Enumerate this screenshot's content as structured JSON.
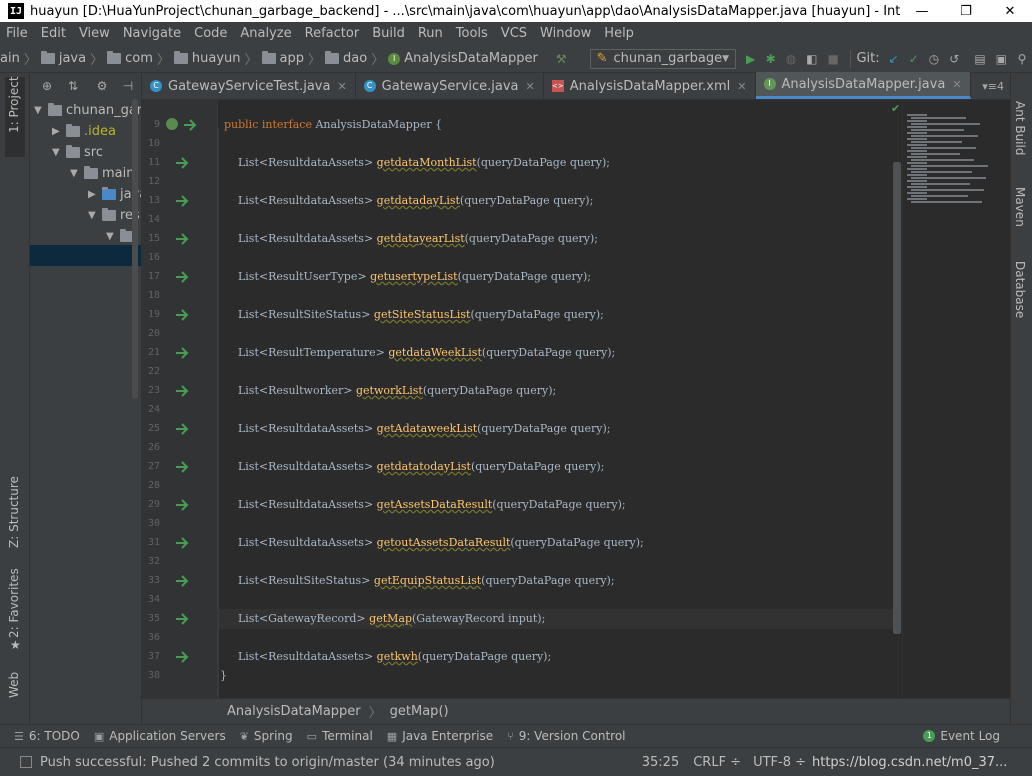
{
  "window": {
    "title": "huayun [D:\\HuaYunProject\\chunan_garbage_backend] - ...\\src\\main\\java\\com\\huayun\\app\\dao\\AnalysisDataMapper.java [huayun] - IntelliJ IDEA",
    "app_icon_text": "IJ"
  },
  "menu": [
    "File",
    "Edit",
    "View",
    "Navigate",
    "Code",
    "Analyze",
    "Refactor",
    "Build",
    "Run",
    "Tools",
    "VCS",
    "Window",
    "Help"
  ],
  "nav": {
    "crumbs": [
      "ain",
      "java",
      "com",
      "huayun",
      "app",
      "dao",
      "AnalysisDataMapper"
    ],
    "run_config": "chunan_garbage",
    "git_label": "Git:"
  },
  "left_strip": {
    "project": "1: Project",
    "structure": "Z: Structure",
    "favorites": "2: Favorites",
    "web": "Web"
  },
  "project_tree": [
    {
      "label": "chunan_garb",
      "indent": 0,
      "arrow": "▼",
      "icon": "folder"
    },
    {
      "label": ".idea",
      "indent": 1,
      "arrow": "▶",
      "icon": "folder",
      "color": "#bbb529"
    },
    {
      "label": "src",
      "indent": 1,
      "arrow": "▼",
      "icon": "folder"
    },
    {
      "label": "main",
      "indent": 2,
      "arrow": "▼",
      "icon": "folder"
    },
    {
      "label": "java",
      "indent": 3,
      "arrow": "▶",
      "icon": "folder"
    },
    {
      "label": "res",
      "indent": 3,
      "arrow": "▼",
      "icon": "folder"
    },
    {
      "label": "",
      "indent": 4,
      "arrow": "▼",
      "icon": "folder"
    }
  ],
  "tabs": [
    {
      "label": "GatewayServiceTest.java",
      "icon": "C",
      "active": false
    },
    {
      "label": "GatewayService.java",
      "icon": "C",
      "active": false
    },
    {
      "label": "AnalysisDataMapper.xml",
      "icon": "xml",
      "active": false
    },
    {
      "label": "AnalysisDataMapper.java",
      "icon": "I",
      "active": true
    }
  ],
  "tab_overflow": "4",
  "code": {
    "header_line": "9",
    "header": {
      "kw": "public interface ",
      "name": "AnalysisDataMapper",
      "rest": " {"
    },
    "lines": [
      {
        "ln": "11",
        "prefix": "    List<ResultdataAssets> ",
        "method": "getdataMonthList",
        "suffix": "(queryDataPage query);"
      },
      {
        "ln": "13",
        "prefix": "    List<ResultdataAssets> ",
        "method": "getdatadayList",
        "suffix": "(queryDataPage query);"
      },
      {
        "ln": "15",
        "prefix": "    List<ResultdataAssets> ",
        "method": "getdatayearList",
        "suffix": "(queryDataPage query);"
      },
      {
        "ln": "17",
        "prefix": "    List<ResultUserType> ",
        "method": "getusertypeList",
        "suffix": "(queryDataPage query);"
      },
      {
        "ln": "19",
        "prefix": "    List<ResultSiteStatus> ",
        "method": "getSiteStatusList",
        "suffix": "(queryDataPage query);"
      },
      {
        "ln": "21",
        "prefix": "    List<ResultTemperature> ",
        "method": "getdataWeekList",
        "suffix": "(queryDataPage query);"
      },
      {
        "ln": "23",
        "prefix": "    List<Resultworker> ",
        "method": "getworkList",
        "suffix": "(queryDataPage query);"
      },
      {
        "ln": "25",
        "prefix": "    List<ResultdataAssets> ",
        "method": "getAdataweekList",
        "suffix": "(queryDataPage query);"
      },
      {
        "ln": "27",
        "prefix": "    List<ResultdataAssets> ",
        "method": "getdatatodayList",
        "suffix": "(queryDataPage query);"
      },
      {
        "ln": "29",
        "prefix": "    List<ResultdataAssets> ",
        "method": "getAssetsDataResult",
        "suffix": "(queryDataPage query);"
      },
      {
        "ln": "31",
        "prefix": "    List<ResultdataAssets> ",
        "method": "getoutAssetsDataResult",
        "suffix": "(queryDataPage query);"
      },
      {
        "ln": "33",
        "prefix": "    List<ResultSiteStatus> ",
        "method": "getEquipStatusList",
        "suffix": "(queryDataPage query);"
      },
      {
        "ln": "35",
        "prefix": "    List<GatewayRecord> ",
        "method": "getMap",
        "suffix": "(GatewayRecord input);"
      },
      {
        "ln": "37",
        "prefix": "    List<ResultdataAssets> ",
        "method": "getkwh",
        "suffix": "(queryDataPage query);"
      }
    ],
    "blank_lines": [
      "10",
      "12",
      "14",
      "16",
      "18",
      "20",
      "22",
      "24",
      "26",
      "28",
      "30",
      "32",
      "34",
      "36",
      "38"
    ],
    "closing": "}"
  },
  "right_strip": {
    "ant": "Ant Build",
    "maven": "Maven",
    "database": "Database"
  },
  "editor_breadcrumb": [
    "AnalysisDataMapper",
    "getMap()"
  ],
  "bottom_tools": [
    {
      "glyph": "☰",
      "label": "6: TODO"
    },
    {
      "glyph": "▣",
      "label": "Application Servers"
    },
    {
      "glyph": "❦",
      "label": "Spring"
    },
    {
      "glyph": "▭",
      "label": "Terminal"
    },
    {
      "glyph": "▦",
      "label": "Java Enterprise"
    },
    {
      "glyph": "⑂",
      "label": "9: Version Control"
    }
  ],
  "event_log": "Event Log",
  "status": {
    "message": "Push successful: Pushed 2 commits to origin/master (34 minutes ago)",
    "position": "35:25",
    "line_sep": "CRLF ÷",
    "encoding": "UTF-8 ÷",
    "watermark": "https://blog.csdn.net/m0_37..."
  },
  "colors": {
    "accent": "#4a88c7",
    "keyword": "#cc7832",
    "method": "#ffc66d",
    "text": "#a9b7c6",
    "green_arrow": "#499c54"
  }
}
